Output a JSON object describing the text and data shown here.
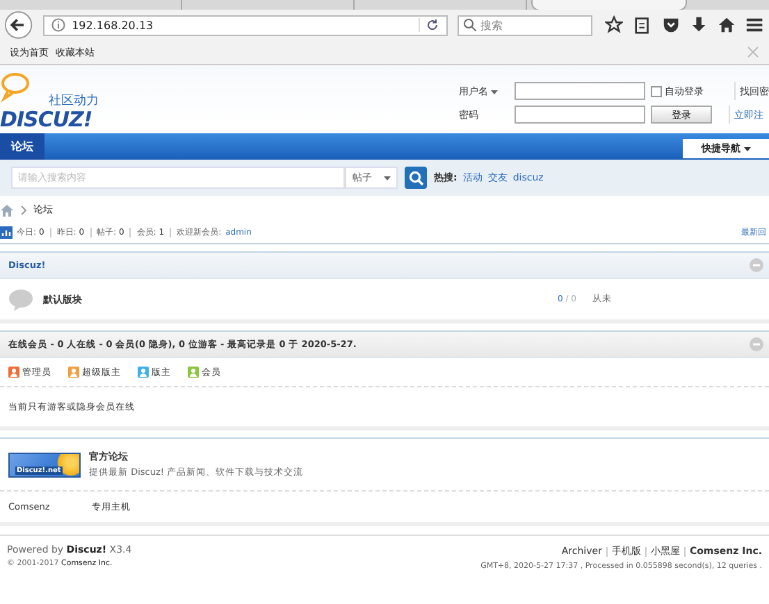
{
  "browser": {
    "tabs": [
      {
        "selected": false
      },
      {
        "selected": false
      },
      {
        "selected": false
      },
      {
        "selected": true
      }
    ],
    "url": "192.168.20.13",
    "search_placeholder": "搜索",
    "bookmarks": [
      "设为首页",
      "收藏本站"
    ]
  },
  "header": {
    "logo_tagline": "社区动力",
    "logo_text": "DISCUZ!",
    "username_label": "用户名",
    "password_label": "密码",
    "auto_login": {
      "label": "自动登录",
      "checked": false
    },
    "login_button": "登录",
    "forgot_link": "找回密",
    "register_link": "立即注"
  },
  "nav": {
    "items": [
      {
        "label": "论坛",
        "selected": true
      }
    ],
    "quick_nav": "快捷导航"
  },
  "search": {
    "placeholder": "请输入搜索内容",
    "scope": "帖子",
    "hot_label": "热搜:",
    "hot_terms": [
      "活动",
      "交友",
      "discuz"
    ]
  },
  "breadcrumb": [
    "论坛"
  ],
  "stats": {
    "items": [
      {
        "label": "今日:",
        "value": "0"
      },
      {
        "label": "昨日:",
        "value": "0"
      },
      {
        "label": "帖子:",
        "value": "0"
      },
      {
        "label": "会员:",
        "value": "1"
      }
    ],
    "welcome": "欢迎新会员:",
    "new_member": "admin",
    "latest_link": "最新回"
  },
  "category": {
    "title": "Discuz!",
    "forums": [
      {
        "name": "默认版块",
        "threads": "0",
        "posts": "/ 0",
        "last_post": "从未"
      }
    ]
  },
  "online": {
    "title": "在线会员 - 0 人在线 - 0 会员(0 隐身), 0 位游客 - 最高记录是 0 于 2020-5-27.",
    "legend": [
      {
        "label": "管理员",
        "color": "#f26c3a"
      },
      {
        "label": "超级版主",
        "color": "#f0a040"
      },
      {
        "label": "版主",
        "color": "#3fb0e8"
      },
      {
        "label": "会员",
        "color": "#8cc63f"
      }
    ],
    "message": "当前只有游客或隐身会员在线"
  },
  "links": {
    "featured": {
      "title": "官方论坛",
      "description": "提供最新 Discuz! 产品新闻、软件下载与技术交流",
      "banner_text": "Discuz!.net"
    },
    "text_links": [
      "Comsenz",
      "专用主机"
    ]
  },
  "footer": {
    "powered_prefix": "Powered by",
    "powered_name": "Discuz!",
    "version": "X3.4",
    "copyright": "© 2001-2017",
    "copyright_owner": "Comsenz Inc.",
    "links": [
      "Archiver",
      "手机版",
      "小黑屋"
    ],
    "company": "Comsenz Inc.",
    "debug": "GMT+8, 2020-5-27 17:37 , Processed in 0.055898 second(s), 12 queries ."
  }
}
